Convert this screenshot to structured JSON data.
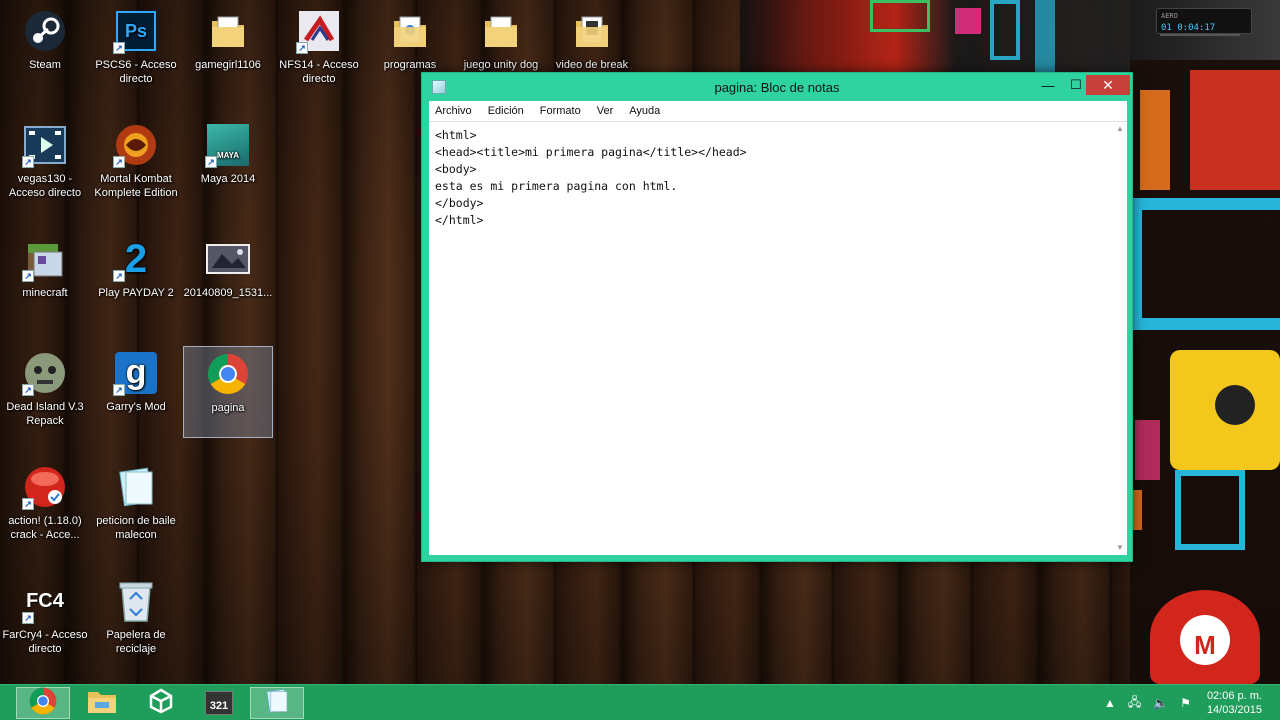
{
  "desktop": {
    "icons": [
      {
        "label": "Steam"
      },
      {
        "label": "PSCS6 - Acceso directo",
        "glyph": "Ps"
      },
      {
        "label": "gamegirl1106"
      },
      {
        "label": "NFS14 - Acceso directo"
      },
      {
        "label": "programas"
      },
      {
        "label": "juego unity dog"
      },
      {
        "label": "video de break"
      },
      {
        "label": "vegas130 - Acceso directo"
      },
      {
        "label": "Mortal Kombat Komplete Edition"
      },
      {
        "label": "Maya 2014",
        "glyph": "MAYA"
      },
      {
        "label": "minecraft"
      },
      {
        "label": "Play PAYDAY 2",
        "glyph": "2"
      },
      {
        "label": "20140809_1531..."
      },
      {
        "label": "Dead Island V.3 Repack"
      },
      {
        "label": "Garry's Mod",
        "glyph": "g"
      },
      {
        "label": "pagina"
      },
      {
        "label": "action! (1.18.0) crack - Acce..."
      },
      {
        "label": "peticion de baile malecon"
      },
      {
        "label": "FarCry4 - Acceso directo",
        "glyph": "FC4"
      },
      {
        "label": "Papelera de reciclaje"
      }
    ]
  },
  "notepad": {
    "title": "pagina: Bloc de notas",
    "menu": [
      "Archivo",
      "Edición",
      "Formato",
      "Ver",
      "Ayuda"
    ],
    "content": "<html>\n<head><title>mi primera pagina</title></head>\n<body>\nesta es mi primera pagina con html.\n</body>\n</html>",
    "buttons": {
      "minimize": "—",
      "maximize": "☐",
      "close": "✕"
    }
  },
  "taskbar": {
    "apps": [
      "chrome",
      "file-explorer",
      "unity",
      "action",
      "notepad"
    ],
    "action_glyph": "321",
    "tray": {
      "time": "02:06 p. m.",
      "date": "14/03/2015"
    }
  },
  "colors": {
    "window_accent": "#2ed3a0",
    "taskbar": "#1f9e5b",
    "close_button": "#c7403a"
  }
}
